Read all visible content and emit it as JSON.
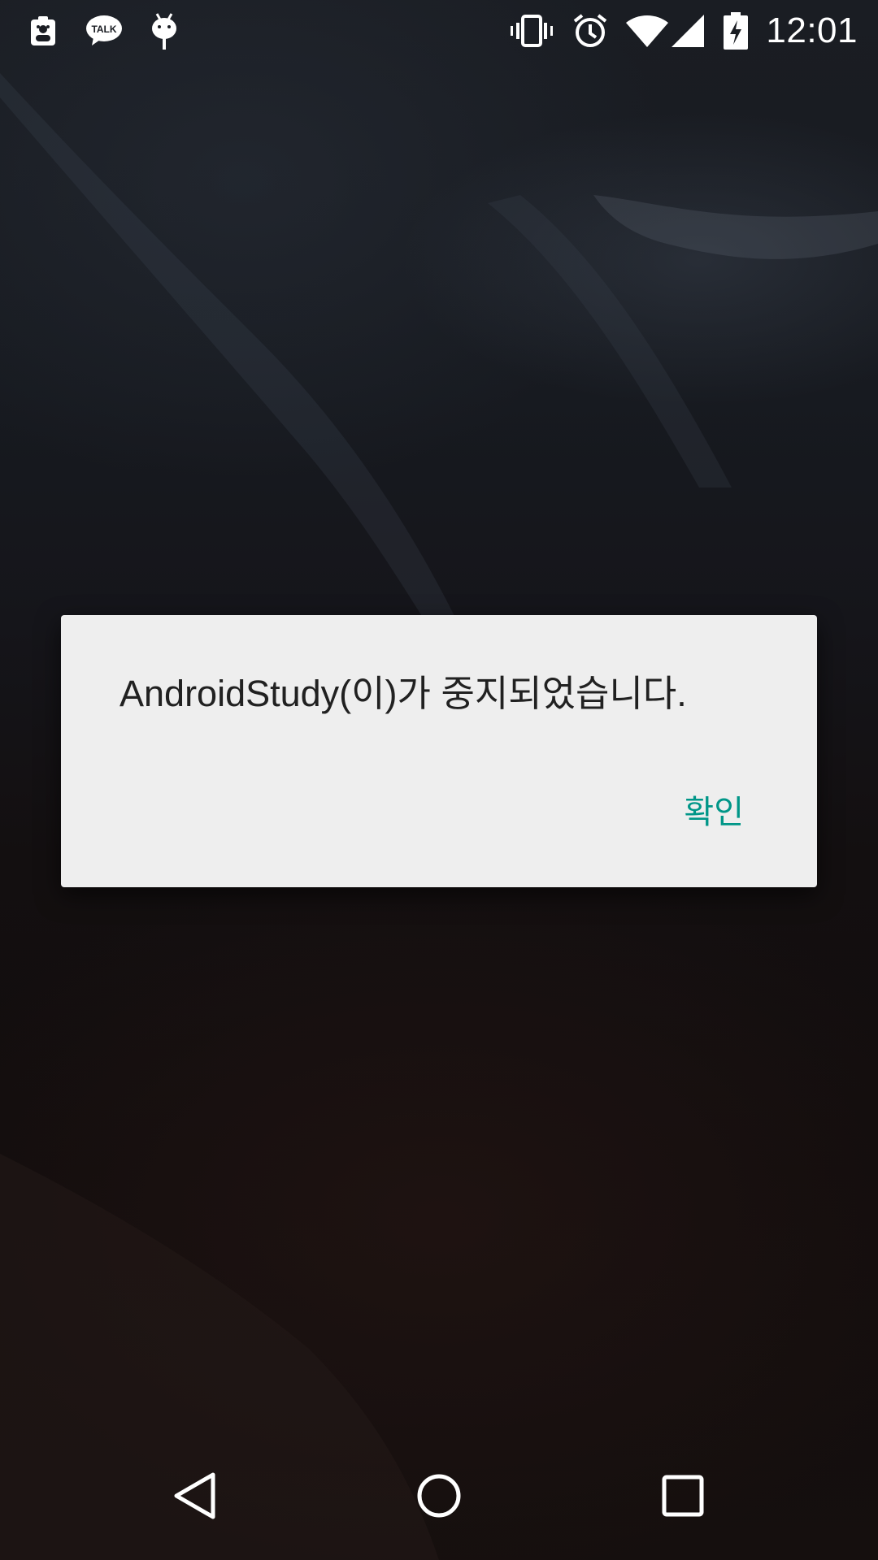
{
  "status_bar": {
    "clock": "12:01",
    "notification_icons": [
      "clipboard-person-icon",
      "kakaotalk-icon",
      "android-debug-icon"
    ],
    "kakao_label": "TALK",
    "system_icons": [
      "vibrate-icon",
      "alarm-icon",
      "wifi-icon",
      "cell-signal-icon",
      "battery-charging-icon"
    ]
  },
  "dialog": {
    "message": "AndroidStudy(이)가 중지되었습니다.",
    "confirm_label": "확인"
  },
  "colors": {
    "dialog_background": "#eeeeee",
    "accent": "#009688",
    "message_text": "#212121"
  },
  "navigation": {
    "buttons": [
      "back-icon",
      "home-icon",
      "recents-icon"
    ]
  }
}
